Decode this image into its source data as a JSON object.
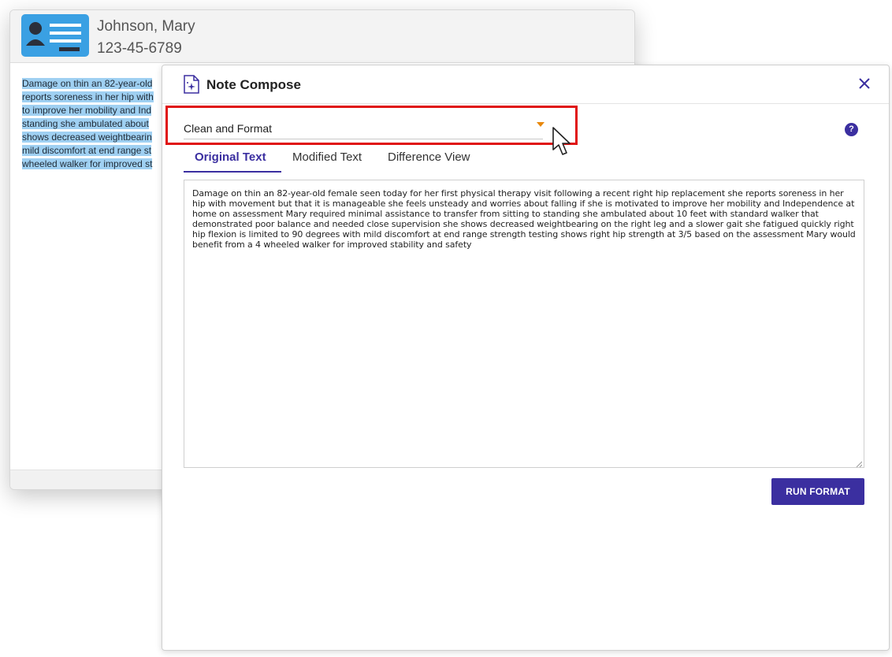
{
  "patient": {
    "name": "Johnson, Mary",
    "id": "123-45-6789",
    "note_lines": [
      "Damage on thin an 82-year-old",
      "reports soreness in her hip with",
      "to improve her mobility and Ind",
      "standing she ambulated about",
      "shows decreased weightbearin",
      "mild discomfort at end range st",
      "wheeled walker for improved st"
    ]
  },
  "dialog": {
    "title": "Note Compose",
    "mode_select": {
      "value": "Clean and Format"
    },
    "help_label": "?",
    "tabs": [
      {
        "label": "Original Text",
        "active": true
      },
      {
        "label": "Modified Text",
        "active": false
      },
      {
        "label": "Difference View",
        "active": false
      }
    ],
    "original_text": "Damage on thin an 82-year-old female seen today for her first physical therapy visit following a recent right hip replacement she reports soreness in her hip with movement but that it is manageable she feels unsteady and worries about falling if she is motivated to improve her mobility and Independence at home on assessment Mary required minimal assistance to transfer from sitting to standing she ambulated about 10 feet with standard walker that demonstrated poor balance and needed close supervision she shows decreased weightbearing on the right leg and a slower gait she fatigued quickly right hip flexion is limited to 90 degrees with mild discomfort at end range strength testing shows right hip strength at 3/5 based on the assessment Mary would benefit from a 4 wheeled walker for improved stability and safety",
    "run_button": "RUN FORMAT"
  },
  "colors": {
    "accent": "#3b2fa0",
    "caret": "#e8880c",
    "highlight_box": "#e01212",
    "selection": "#9fd0f2",
    "avatar_card": "#3aa0e3"
  },
  "icons": [
    "patient-card-icon",
    "note-compose-icon",
    "close-icon",
    "help-icon",
    "dropdown-caret-icon",
    "mouse-pointer-icon"
  ]
}
